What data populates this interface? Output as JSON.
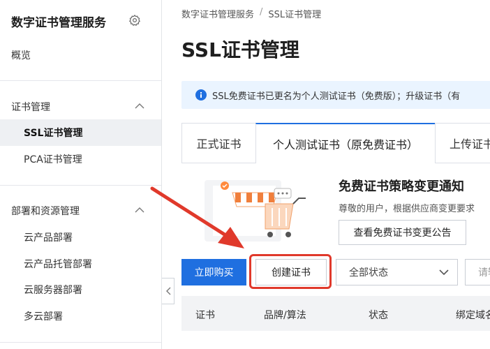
{
  "sidebar": {
    "title": "数字证书管理服务",
    "overview": "概览",
    "cert_group": "证书管理",
    "cert_items": [
      "SSL证书管理",
      "PCA证书管理"
    ],
    "deploy_group": "部署和资源管理",
    "deploy_items": [
      "云产品部署",
      "云产品托管部署",
      "云服务器部署",
      "多云部署"
    ]
  },
  "breadcrumb": [
    "数字证书管理服务",
    "SSL证书管理"
  ],
  "page_title": "SSL证书管理",
  "notice": "SSL免费证书已更名为个人测试证书（免费版）；升级证书（有",
  "tabs": [
    "正式证书",
    "个人测试证书（原免费证书）",
    "上传证书"
  ],
  "promo": {
    "title": "免费证书策略变更通知",
    "subtitle": "尊敬的用户，根据供应商变更要求",
    "button": "查看免费证书变更公告"
  },
  "toolbar": {
    "buy": "立即购买",
    "create": "创建证书",
    "status": "全部状态",
    "search_placeholder": "请输"
  },
  "table": {
    "headers": [
      "证书",
      "品牌/算法",
      "状态",
      "绑定域名"
    ]
  },
  "colors": {
    "primary": "#1f6fe0",
    "highlight": "#e0392b",
    "notice_bg": "#eaf4ff"
  }
}
